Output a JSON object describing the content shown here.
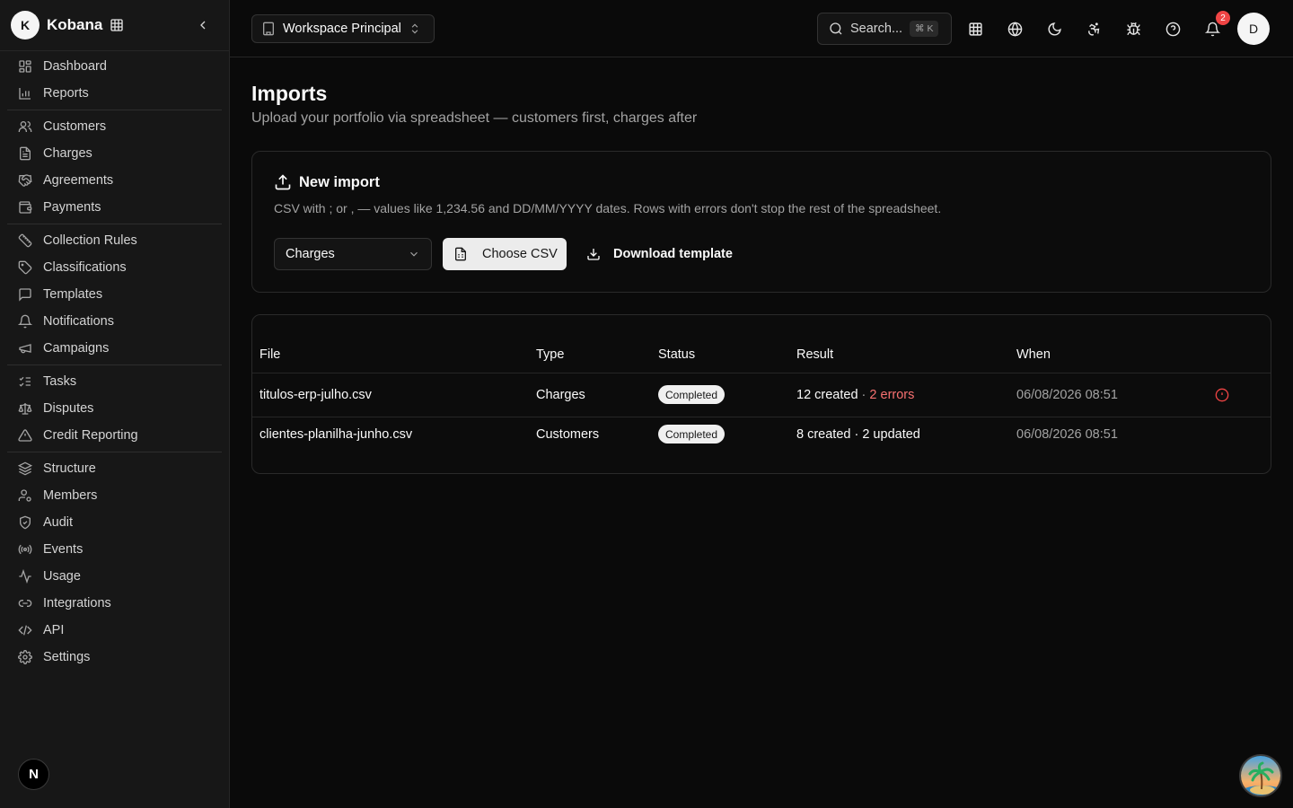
{
  "brand": {
    "initial": "K",
    "name": "Kobana"
  },
  "sidebar": {
    "groups": [
      [
        {
          "label": "Dashboard",
          "icon": "dashboard-icon"
        },
        {
          "label": "Reports",
          "icon": "bar-chart-icon"
        }
      ],
      [
        {
          "label": "Customers",
          "icon": "users-icon"
        },
        {
          "label": "Charges",
          "icon": "file-text-icon"
        },
        {
          "label": "Agreements",
          "icon": "handshake-icon"
        },
        {
          "label": "Payments",
          "icon": "wallet-icon"
        }
      ],
      [
        {
          "label": "Collection Rules",
          "icon": "pen-ruler-icon"
        },
        {
          "label": "Classifications",
          "icon": "tag-icon"
        },
        {
          "label": "Templates",
          "icon": "message-square-icon"
        },
        {
          "label": "Notifications",
          "icon": "bell-icon"
        },
        {
          "label": "Campaigns",
          "icon": "megaphone-icon"
        }
      ],
      [
        {
          "label": "Tasks",
          "icon": "list-checks-icon"
        },
        {
          "label": "Disputes",
          "icon": "scale-icon"
        },
        {
          "label": "Credit Reporting",
          "icon": "alert-triangle-icon"
        }
      ],
      [
        {
          "label": "Structure",
          "icon": "layers-icon"
        },
        {
          "label": "Members",
          "icon": "user-cog-icon"
        },
        {
          "label": "Audit",
          "icon": "shield-check-icon"
        },
        {
          "label": "Events",
          "icon": "radio-icon"
        },
        {
          "label": "Usage",
          "icon": "activity-icon"
        },
        {
          "label": "Integrations",
          "icon": "link-icon"
        },
        {
          "label": "API",
          "icon": "code-icon"
        },
        {
          "label": "Settings",
          "icon": "gear-icon"
        }
      ]
    ],
    "footer_initial": "N"
  },
  "topbar": {
    "workspace": "Workspace Principal",
    "search_placeholder": "Search...",
    "search_shortcut": "⌘ K",
    "notification_count": "2",
    "user_initial": "D"
  },
  "page": {
    "title": "Imports",
    "subtitle": "Upload your portfolio via spreadsheet — customers first, charges after"
  },
  "new_import": {
    "title": "New import",
    "description": "CSV with ; or , — values like 1,234.56 and DD/MM/YYYY dates. Rows with errors don't stop the rest of the spreadsheet.",
    "type_selected": "Charges",
    "choose_csv_label": "Choose CSV",
    "download_template_label": "Download template"
  },
  "imports_table": {
    "columns": [
      "File",
      "Type",
      "Status",
      "Result",
      "When"
    ],
    "rows": [
      {
        "file": "titulos-erp-julho.csv",
        "type": "Charges",
        "status": "Completed",
        "result_main": "12 created",
        "result_sep": " · ",
        "result_extra": "2 errors",
        "when": "06/08/2026 08:51",
        "has_alert": true
      },
      {
        "file": "clientes-planilha-junho.csv",
        "type": "Customers",
        "status": "Completed",
        "result_main": "8 created · 2 updated",
        "when": "06/08/2026 08:51",
        "has_alert": false
      }
    ]
  },
  "colors": {
    "background": "#0a0a0a",
    "sidebar": "#171717",
    "error": "#ef4444",
    "badge": "#f0f0f0"
  }
}
